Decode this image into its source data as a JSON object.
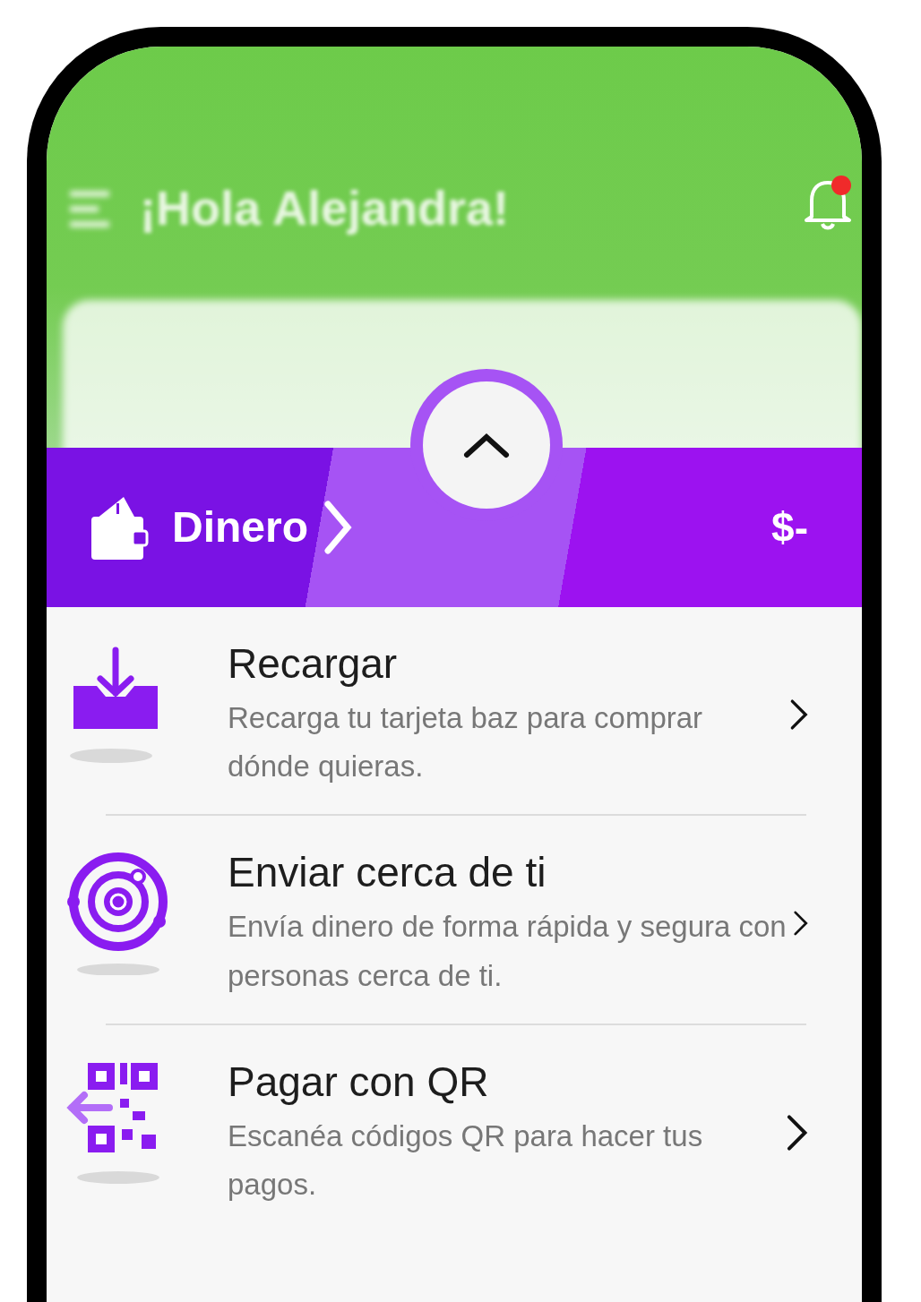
{
  "header": {
    "greeting": "¡Hola Alejandra!",
    "notification_badge": true
  },
  "balance_bar": {
    "label": "Dinero",
    "amount": "$-"
  },
  "actions": [
    {
      "kind": "top-up",
      "title": "Recargar",
      "description": "Recarga tu tarjeta baz para comprar dónde quieras."
    },
    {
      "kind": "send-nearby",
      "title": "Enviar cerca de ti",
      "description": "Envía dinero de forma rápida y segura con personas cerca de ti."
    },
    {
      "kind": "qr-pay",
      "title": "Pagar con QR",
      "description": "Escanéa códigos QR para hacer tus pagos."
    }
  ]
}
